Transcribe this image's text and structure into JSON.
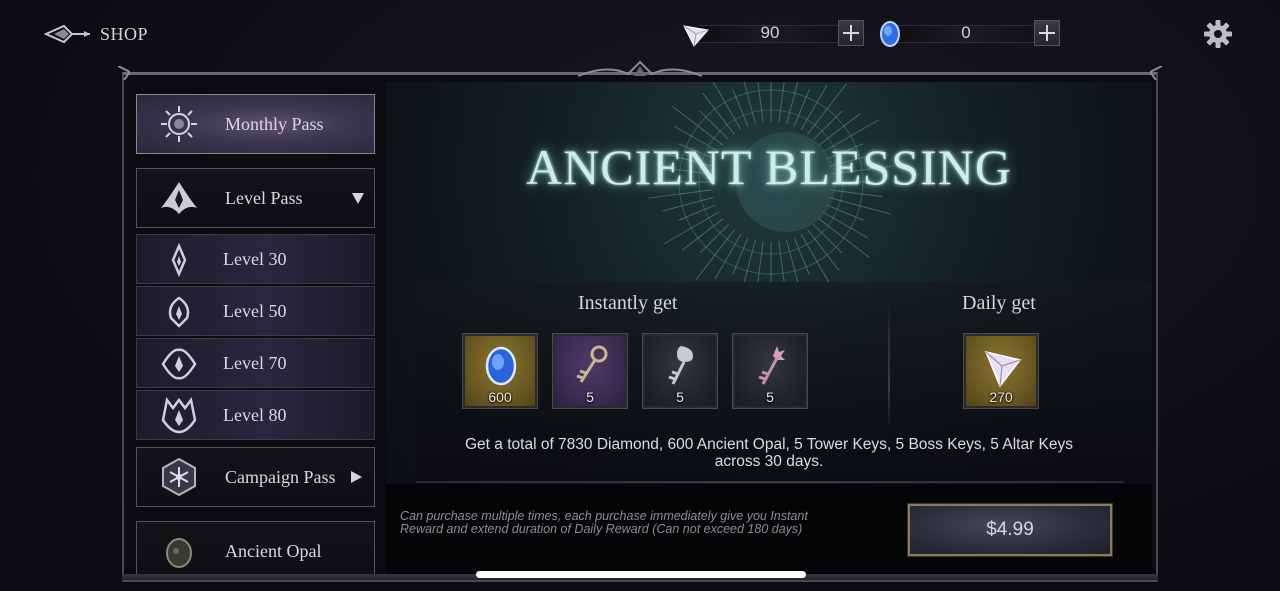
{
  "header": {
    "back_label": "SHOP",
    "currencies": [
      {
        "name": "diamond",
        "icon": "diamond-icon",
        "value": "90"
      },
      {
        "name": "ancient-opal",
        "icon": "opal-icon",
        "value": "0"
      }
    ],
    "settings_icon": "gear-icon"
  },
  "sidebar": {
    "items": [
      {
        "label": "Monthly Pass",
        "icon": "sun-moon-emblem-icon",
        "state": "active"
      },
      {
        "label": "Level Pass",
        "icon": "level-pass-crest-icon",
        "state": "expanded",
        "indicator": "chevron-down"
      },
      {
        "label": "Level 30",
        "icon": "level-30-crest-icon"
      },
      {
        "label": "Level 50",
        "icon": "level-50-crest-icon"
      },
      {
        "label": "Level 70",
        "icon": "level-70-crest-icon"
      },
      {
        "label": "Level 80",
        "icon": "level-80-crest-icon"
      },
      {
        "label": "Campaign Pass",
        "icon": "campaign-emblem-icon",
        "indicator": "chevron-right"
      },
      {
        "label": "Ancient Opal",
        "icon": "opal-emblem-icon"
      }
    ]
  },
  "offer": {
    "title": "ANCIENT BLESSING",
    "instant_title": "Instantly get",
    "daily_title": "Daily get",
    "instant_rewards": [
      {
        "item": "Ancient Opal",
        "icon": "opal-icon",
        "qty": "600",
        "rarity_color": "#7a6628"
      },
      {
        "item": "Tower Key",
        "icon": "gold-key-icon",
        "qty": "5",
        "rarity_color": "#46345c"
      },
      {
        "item": "Boss Key",
        "icon": "silver-key-icon",
        "qty": "5",
        "rarity_color": "#2a2d33"
      },
      {
        "item": "Altar Key",
        "icon": "pink-key-icon",
        "qty": "5",
        "rarity_color": "#2a2d33"
      }
    ],
    "daily_rewards": [
      {
        "item": "Diamond",
        "icon": "diamond-icon",
        "qty": "270",
        "rarity_color": "#7a6628"
      }
    ],
    "summary_line1": "Get a total of 7830 Diamond,  600 Ancient Opal, 5 Tower Keys, 5 Boss Keys, 5 Altar Keys",
    "summary_line2": "across 30 days.",
    "note_line1": "Can purchase multiple times, each purchase immediately give you Instant",
    "note_line2": "Reward and extend duration of Daily Reward (Can not exceed 180 days)",
    "price": "$4.99"
  },
  "colors": {
    "accent_teal": "#cdeee6",
    "button_border": "#8a7c5a",
    "active_tab": "#4a4260"
  }
}
